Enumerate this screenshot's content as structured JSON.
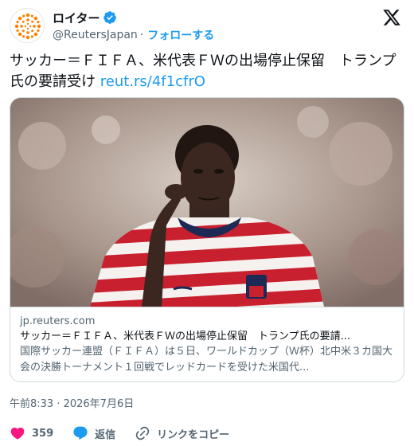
{
  "account": {
    "display_name": "ロイター",
    "handle": "@ReutersJapan",
    "separator": "·",
    "follow_label": "フォローする"
  },
  "tweet": {
    "text": "サッカー＝ＦＩＦＡ、米代表ＦＷの出場停止保留　トランプ氏の要請受け",
    "link": "reut.rs/4f1cfrO"
  },
  "card": {
    "domain": "jp.reuters.com",
    "title": "サッカー＝ＦＩＦＡ、米代表ＦＷの出場停止保留　トランプ氏の要請...",
    "description": "国際サッカー連盟（ＦＩＦＡ）は５日、ワールドカップ（Ｗ杯）北中米３カ国大会の決勝トーナメント１回戦でレッドカードを受けた米国代..."
  },
  "timestamp": "午前8:33 · 2026年7月6日",
  "actions": {
    "like_count": "359",
    "reply_label": "返信",
    "copy_link_label": "リンクをコピー"
  },
  "colors": {
    "accent": "#1d9bf0",
    "like": "#f91880",
    "text_secondary": "#536471"
  }
}
